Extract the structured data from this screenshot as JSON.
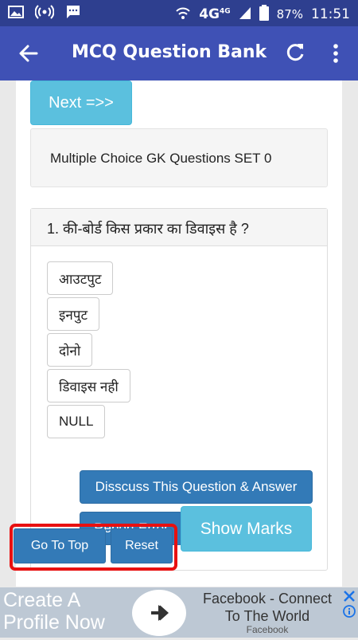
{
  "statusbar": {
    "network": "4G",
    "network_sup": "4G",
    "battery": "87%",
    "time": "11:51",
    "icons": [
      "image-icon",
      "hotspot-icon",
      "message-icon",
      "wifi-icon",
      "signal-icon",
      "battery-icon"
    ]
  },
  "toolbar": {
    "title": "MCQ Question Bank",
    "icons": [
      "back-arrow-icon",
      "refresh-icon",
      "more-vert-icon"
    ]
  },
  "main": {
    "next_label": "Next =>>",
    "set_title": "Multiple Choice GK Questions SET 0",
    "question": "1. की-बोर्ड किस प्रकार का डिवाइस है ?",
    "options": [
      "आउटपुट",
      "इनपुट",
      "दोनो",
      "डिवाइस नही",
      "NULL"
    ],
    "discuss_label": "Disscuss This Question & Answer",
    "report_label": "Report Error",
    "show_marks_label": "Show Marks"
  },
  "float": {
    "top_label": "Go To Top",
    "reset_label": "Reset"
  },
  "ad": {
    "headline": "Create A Profile Now",
    "body": "Facebook - Connect To The World",
    "source": "Facebook",
    "icons": [
      "arrow-right-icon",
      "close-icon",
      "info-icon"
    ]
  },
  "colors": {
    "status_bar": "#2e3f8f",
    "toolbar": "#3f51b5",
    "primary_button": "#337ab7",
    "info_button": "#5bc0de",
    "highlight_border": "#e81010"
  }
}
